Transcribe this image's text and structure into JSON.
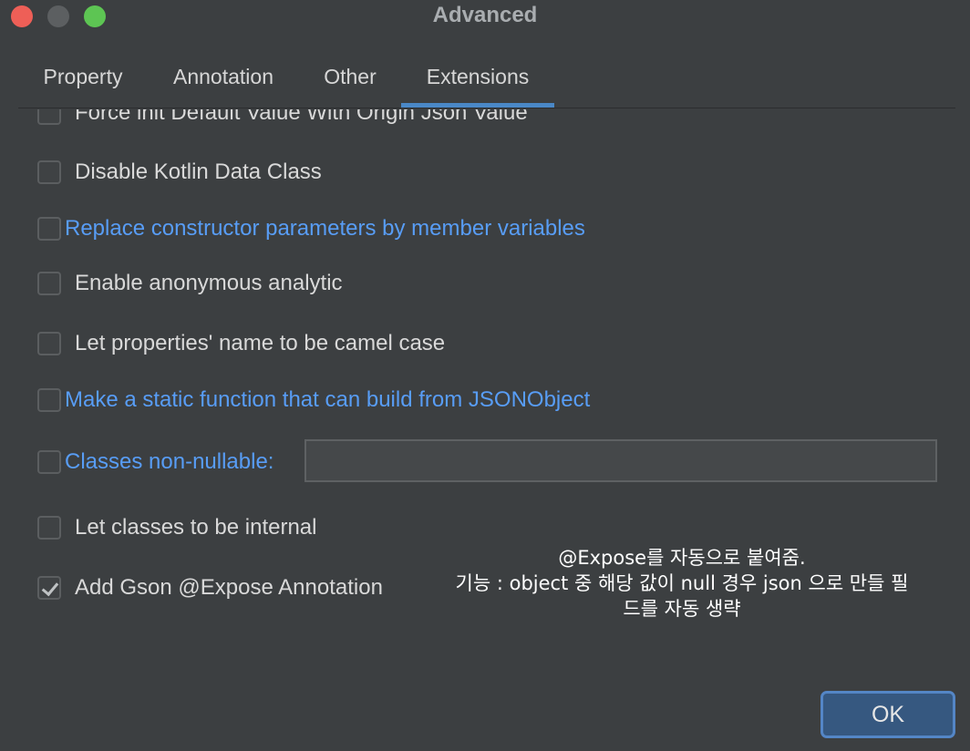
{
  "window": {
    "title": "Advanced"
  },
  "tabs": [
    {
      "label": "Property",
      "active": false
    },
    {
      "label": "Annotation",
      "active": false
    },
    {
      "label": "Other",
      "active": false
    },
    {
      "label": "Extensions",
      "active": true
    }
  ],
  "options": {
    "force_init": {
      "label": "Force init Default Value With Origin Json Value",
      "checked": false
    },
    "disable_data_class": {
      "label": "Disable Kotlin Data Class",
      "checked": false
    },
    "replace_constructor": {
      "label": "Replace constructor parameters by member variables",
      "checked": false
    },
    "anonymous_analytic": {
      "label": "Enable anonymous analytic",
      "checked": false
    },
    "camel_case": {
      "label": "Let properties' name to be camel case",
      "checked": false
    },
    "static_function": {
      "label": "Make a static function that can build from JSONObject",
      "checked": false
    },
    "non_nullable": {
      "label": "Classes non-nullable:",
      "checked": false,
      "value": ""
    },
    "internal_classes": {
      "label": "Let classes to be internal",
      "checked": false
    },
    "gson_expose": {
      "label": "Add Gson @Expose Annotation",
      "checked": true
    }
  },
  "note": {
    "line1": "@Expose를 자동으로 붙여줌.",
    "line2": "기능 : object 중 해당 값이 null 경우  json 으로 만들 필",
    "line3": "드를 자동 생략"
  },
  "buttons": {
    "ok": "OK"
  },
  "colors": {
    "background": "#3c3f41",
    "accent": "#4a88c7",
    "link_text": "#589df6",
    "close": "#ee5f57",
    "maximize": "#5dc553",
    "ok_button": "#365880"
  }
}
